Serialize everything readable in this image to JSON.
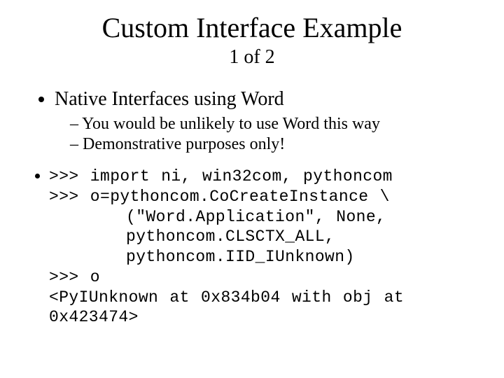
{
  "title": "Custom Interface Example",
  "subtitle": "1 of 2",
  "bullet1": "Native Interfaces using Word",
  "sub1": "You would be unlikely to use Word this way",
  "sub2": "Demonstrative purposes only!",
  "code_line1": ">>> import ni, win32com, pythoncom",
  "code_line2": ">>> o=pythoncom.CoCreateInstance \\",
  "code_line3": "(\"Word.Application\", None,",
  "code_line4": "pythoncom.CLSCTX_ALL,",
  "code_line5": "pythoncom.IID_IUnknown)",
  "code_line6": ">>> o",
  "code_line7": "<PyIUnknown at 0x834b04 with obj at 0x423474>"
}
